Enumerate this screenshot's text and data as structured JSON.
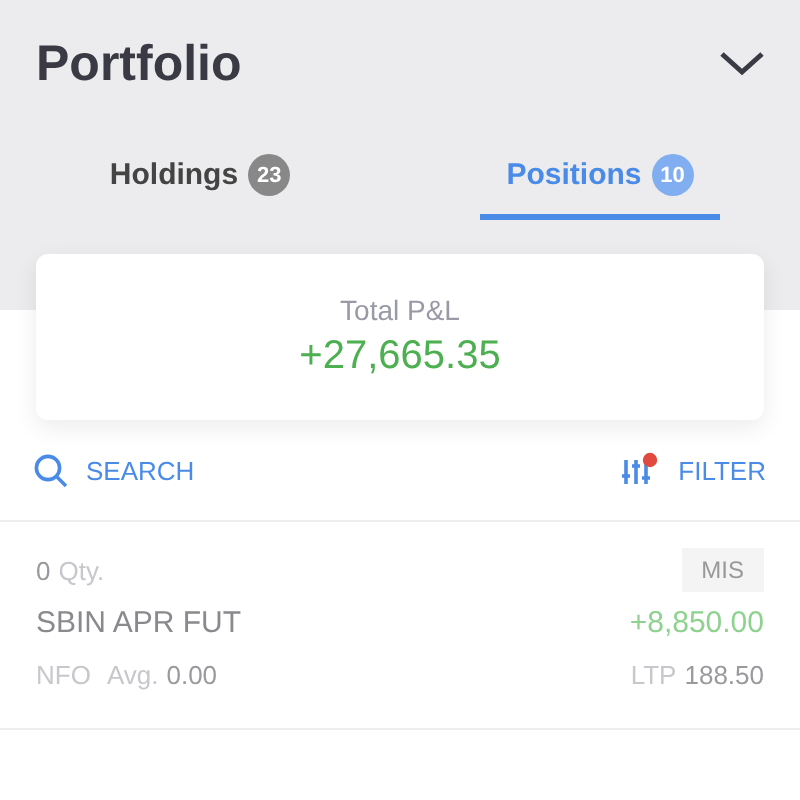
{
  "header": {
    "title": "Portfolio"
  },
  "tabs": [
    {
      "label": "Holdings",
      "count": "23",
      "selected": false
    },
    {
      "label": "Positions",
      "count": "10",
      "selected": true
    }
  ],
  "summary": {
    "label": "Total P&L",
    "value": "+27,665.35"
  },
  "actions": {
    "search": "SEARCH",
    "filter": "FILTER",
    "filter_active": true
  },
  "positions": [
    {
      "qty": "0",
      "qty_label": "Qty.",
      "product": "MIS",
      "symbol": "SBIN APR FUT",
      "pnl": "+8,850.00",
      "exchange": "NFO",
      "avg_label": "Avg.",
      "avg": "0.00",
      "ltp_label": "LTP",
      "ltp": "188.50"
    }
  ]
}
